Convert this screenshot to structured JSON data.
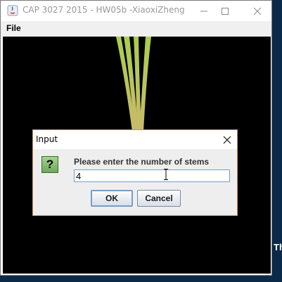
{
  "window": {
    "title": "CAP 3027 2015 - HW05b -XiaoxiZheng",
    "menu": {
      "file": "File"
    }
  },
  "dialog": {
    "title": "Input",
    "prompt": "Please enter the number of stems",
    "input_value": "4",
    "ok_label": "OK",
    "cancel_label": "Cancel"
  },
  "background": {
    "right_edge_text": "Th"
  },
  "colors": {
    "canvas": "#000000",
    "stem_top": "#a9cf4e",
    "stem_bottom": "#c9b96a",
    "dialog_border": "#cc8f60"
  }
}
